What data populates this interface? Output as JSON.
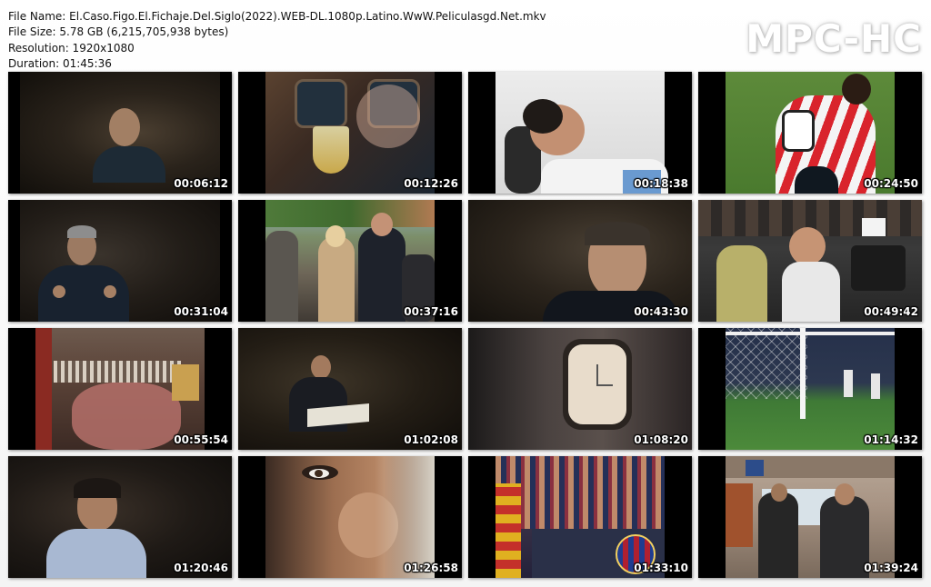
{
  "file_info": {
    "name_line": "File Name: El.Caso.Figo.El.Fichaje.Del.Siglo(2022).WEB-DL.1080p.Latino.WwW.Peliculasgd.Net.mkv",
    "size_line": "File Size: 5.78 GB (6,215,705,938 bytes)",
    "resolution_line": "Resolution: 1920x1080",
    "duration_line": "Duration: 01:45:36"
  },
  "logo": "MPC-HC",
  "thumbnails": [
    {
      "timestamp": "00:06:12",
      "scene": "man-interview-dark"
    },
    {
      "timestamp": "00:12:26",
      "scene": "champagne-glass-toast"
    },
    {
      "timestamp": "00:18:38",
      "scene": "man-in-dentist-chair"
    },
    {
      "timestamp": "00:24:50",
      "scene": "footballer-red-white-jersey"
    },
    {
      "timestamp": "00:31:04",
      "scene": "man-interview-gesturing"
    },
    {
      "timestamp": "00:37:16",
      "scene": "couple-with-photographers"
    },
    {
      "timestamp": "00:43:30",
      "scene": "smiling-man-interview"
    },
    {
      "timestamp": "00:49:42",
      "scene": "press-crowd-cameras"
    },
    {
      "timestamp": "00:55:54",
      "scene": "blurry-crowd-protest"
    },
    {
      "timestamp": "01:02:08",
      "scene": "man-reading-newspaper"
    },
    {
      "timestamp": "01:08:20",
      "scene": "wall-clock"
    },
    {
      "timestamp": "01:14:32",
      "scene": "goal-net-stadium"
    },
    {
      "timestamp": "01:20:46",
      "scene": "man-curly-hair-interview"
    },
    {
      "timestamp": "01:26:58",
      "scene": "face-closeup"
    },
    {
      "timestamp": "01:33:10",
      "scene": "fans-with-banners"
    },
    {
      "timestamp": "01:39:24",
      "scene": "men-in-airport"
    }
  ]
}
